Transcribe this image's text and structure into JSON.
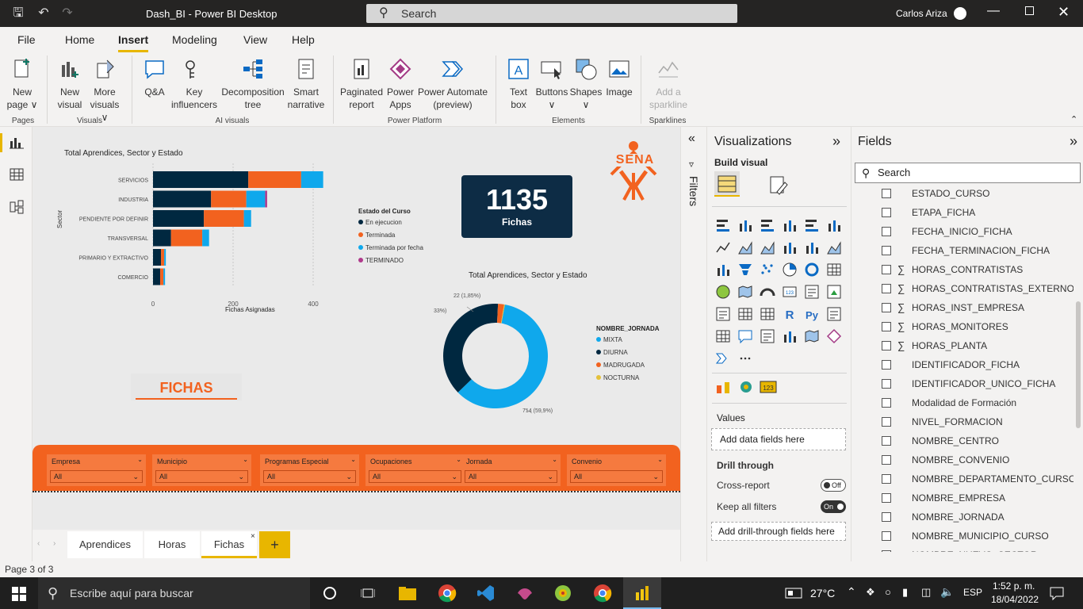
{
  "titlebar": {
    "app_title": "Dash_BI - Power BI Desktop",
    "search": "Search",
    "user": "Carlos Ariza"
  },
  "menu": [
    "File",
    "Home",
    "Insert",
    "Modeling",
    "View",
    "Help"
  ],
  "ribbon": {
    "buttons": [
      {
        "l1": "New",
        "l2": "page ∨"
      },
      {
        "l1": "New",
        "l2": "visual"
      },
      {
        "l1": "More",
        "l2": "visuals ∨"
      },
      {
        "l1": "Q&A",
        "l2": ""
      },
      {
        "l1": "Key",
        "l2": "influencers"
      },
      {
        "l1": "Decomposition",
        "l2": "tree"
      },
      {
        "l1": "Smart",
        "l2": "narrative"
      },
      {
        "l1": "Paginated",
        "l2": "report"
      },
      {
        "l1": "Power",
        "l2": "Apps"
      },
      {
        "l1": "Power Automate",
        "l2": "(preview)"
      },
      {
        "l1": "Text",
        "l2": "box"
      },
      {
        "l1": "Buttons",
        "l2": "∨"
      },
      {
        "l1": "Shapes",
        "l2": "∨"
      },
      {
        "l1": "Image",
        "l2": ""
      },
      {
        "l1": "Add a",
        "l2": "sparkline"
      }
    ],
    "groups": [
      "Pages",
      "Visuals",
      "AI visuals",
      "Power Platform",
      "Elements",
      "Sparklines"
    ]
  },
  "report": {
    "bar_title": "Total Aprendices, Sector y Estado",
    "bar_ylabel": "Sector",
    "bar_xlabel": "Fichas Asignadas",
    "legend_title": "Estado del Curso",
    "card_value": "1135",
    "card_label": "Fichas",
    "fichas_label": "FICHAS",
    "donut_title": "Total Aprendices, Sector y Estado",
    "donut_legend_title": "NOMBRE_JORNADA",
    "donut_labels": {
      "top": "22 (1,85%)",
      "left": "33%)",
      "bottom": "714 (59,9%)"
    },
    "sena": "SENA"
  },
  "chart_data": [
    {
      "type": "bar",
      "title": "Total Aprendices, Sector y Estado",
      "xlabel": "Fichas Asignadas",
      "ylabel": "Sector",
      "categories": [
        "SERVICIOS",
        "INDUSTRIA",
        "PENDIENTE POR DEFINIR",
        "TRANSVERSAL",
        "PRIMARIO Y EXTRACTIVO",
        "COMERCIO"
      ],
      "xticks": [
        "0",
        "200",
        "400"
      ],
      "xlim": [
        0,
        430
      ],
      "series": [
        {
          "name": "En ejecucion",
          "color": "#002840",
          "values": [
            238,
            145,
            127,
            45,
            20,
            18
          ]
        },
        {
          "name": "Terminada",
          "color": "#f2621f",
          "values": [
            132,
            88,
            100,
            78,
            8,
            8
          ]
        },
        {
          "name": "Terminada por fecha",
          "color": "#0fa8ec",
          "values": [
            55,
            47,
            18,
            17,
            4,
            4
          ]
        },
        {
          "name": "TERMINADO",
          "color": "#b03a8c",
          "values": [
            0,
            5,
            0,
            0,
            0,
            0
          ]
        }
      ]
    },
    {
      "type": "pie",
      "title": "Total Aprendices, Sector y Estado",
      "legend_title": "NOMBRE_JORNADA",
      "categories": [
        "MIXTA",
        "DIURNA",
        "MADRUGADA",
        "NOCTURNA"
      ],
      "values": [
        59.9,
        38.0,
        1.85,
        0.25
      ],
      "colors": [
        "#0fa8ec",
        "#002840",
        "#f2621f",
        "#e4c13a"
      ]
    }
  ],
  "slicers": [
    {
      "label": "Empresa",
      "value": "All"
    },
    {
      "label": "Municipio",
      "value": "All"
    },
    {
      "label": "Programas Especial",
      "value": "All"
    },
    {
      "label": "Ocupaciones",
      "value": "All"
    },
    {
      "label": "Jornada",
      "value": "All"
    },
    {
      "label": "Convenio",
      "value": "All"
    }
  ],
  "tabs": [
    "Aprendices",
    "Horas",
    "Fichas"
  ],
  "filters_label": "Filters",
  "viz": {
    "title": "Visualizations",
    "build": "Build visual",
    "values": "Values",
    "add_data": "Add data fields here",
    "drill": "Drill through",
    "cross": "Cross-report",
    "cross_state": "Off",
    "keep": "Keep all filters",
    "keep_state": "On",
    "add_drill": "Add drill-through fields here"
  },
  "fields": {
    "title": "Fields",
    "search": "Search",
    "items": [
      {
        "name": "ESTADO_CURSO",
        "sigma": false
      },
      {
        "name": "ETAPA_FICHA",
        "sigma": false
      },
      {
        "name": "FECHA_INICIO_FICHA",
        "sigma": false
      },
      {
        "name": "FECHA_TERMINACION_FICHA",
        "sigma": false
      },
      {
        "name": "HORAS_CONTRATISTAS",
        "sigma": true
      },
      {
        "name": "HORAS_CONTRATISTAS_EXTERNOS",
        "sigma": true
      },
      {
        "name": "HORAS_INST_EMPRESA",
        "sigma": true
      },
      {
        "name": "HORAS_MONITORES",
        "sigma": true
      },
      {
        "name": "HORAS_PLANTA",
        "sigma": true
      },
      {
        "name": "IDENTIFICADOR_FICHA",
        "sigma": false
      },
      {
        "name": "IDENTIFICADOR_UNICO_FICHA",
        "sigma": false
      },
      {
        "name": "Modalidad de Formación",
        "sigma": false
      },
      {
        "name": "NIVEL_FORMACION",
        "sigma": false
      },
      {
        "name": "NOMBRE_CENTRO",
        "sigma": false
      },
      {
        "name": "NOMBRE_CONVENIO",
        "sigma": false
      },
      {
        "name": "NOMBRE_DEPARTAMENTO_CURSO",
        "sigma": false
      },
      {
        "name": "NOMBRE_EMPRESA",
        "sigma": false
      },
      {
        "name": "NOMBRE_JORNADA",
        "sigma": false
      },
      {
        "name": "NOMBRE_MUNICIPIO_CURSO",
        "sigma": false
      },
      {
        "name": "NOMBRE_NUEVO_SECTOR",
        "sigma": false
      }
    ]
  },
  "status": {
    "page": "Page 3 of 3"
  },
  "taskbar": {
    "search": "Escribe aquí para buscar",
    "temp": "27°C",
    "lang": "ESP",
    "time": "1:52 p. m.",
    "date": "18/04/2022"
  }
}
